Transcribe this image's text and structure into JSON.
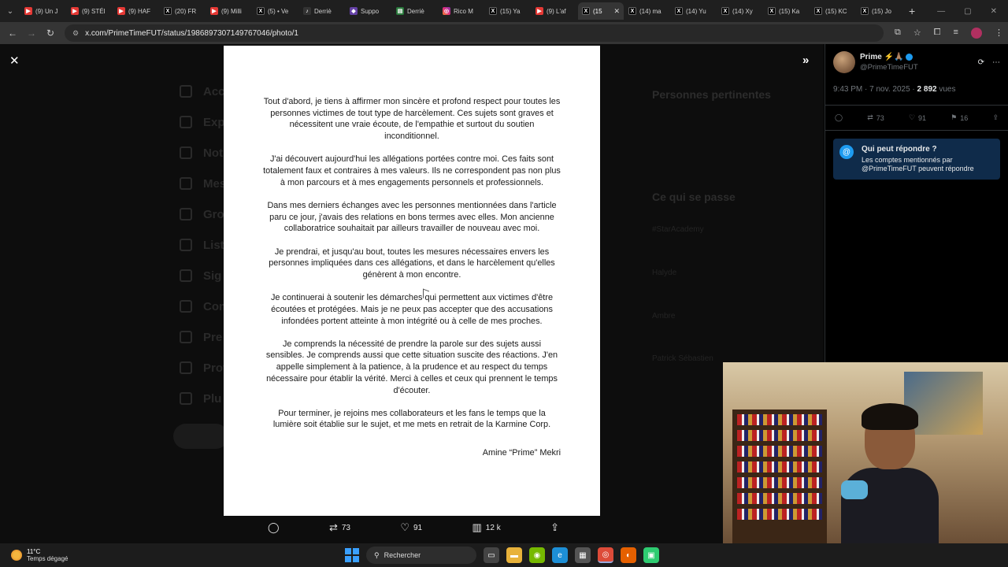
{
  "browser": {
    "tabs": [
      {
        "icon": "youtube-icon",
        "label": "(9) Un J"
      },
      {
        "icon": "youtube-icon",
        "label": "(9) STÉI"
      },
      {
        "icon": "youtube-icon",
        "label": "(9) HAF"
      },
      {
        "icon": "x-icon",
        "label": "(20) FR"
      },
      {
        "icon": "youtube-icon",
        "label": "(9) Milli"
      },
      {
        "icon": "x-icon",
        "label": "(5) • Ve"
      },
      {
        "icon": "tiktok-icon",
        "label": "Derriè"
      },
      {
        "icon": "twitch-icon",
        "label": "Suppo"
      },
      {
        "icon": "doc-icon",
        "label": "Derriè"
      },
      {
        "icon": "instagram-icon",
        "label": "Rico M"
      },
      {
        "icon": "x-icon",
        "label": "(15) Ya"
      },
      {
        "icon": "youtube-icon",
        "label": "(9) L'af"
      },
      {
        "icon": "x-icon",
        "label": "(15",
        "active": true
      },
      {
        "icon": "x-icon",
        "label": "(14) ma"
      },
      {
        "icon": "x-icon",
        "label": "(14) Yu"
      },
      {
        "icon": "x-icon",
        "label": "(14) Xy"
      },
      {
        "icon": "x-icon",
        "label": "(15) Ka"
      },
      {
        "icon": "x-icon",
        "label": "(15) KC"
      },
      {
        "icon": "x-icon",
        "label": "(15) Jo"
      }
    ],
    "url": "x.com/PrimeTimeFUT/status/1986897307149767046/photo/1"
  },
  "background": {
    "nav": [
      "Acc",
      "Exp",
      "Not",
      "Mes",
      "Gro",
      "List",
      "Sig",
      "Com",
      "Pre",
      "Prof",
      "Plu"
    ],
    "right_headings": [
      "Personnes pertinentes",
      "Ce qui se passe"
    ],
    "right_items": [
      "#StarAcademy",
      "Halyde",
      "Ambre",
      "Patrick Sébastien"
    ]
  },
  "statement": {
    "paragraphs": [
      "Tout d'abord, je tiens à affirmer mon sincère et profond respect pour toutes les personnes victimes de tout type de harcèlement. Ces sujets sont graves et nécessitent une vraie écoute, de l'empathie et surtout du soutien inconditionnel.",
      "J'ai découvert aujourd'hui les allégations portées contre moi. Ces faits sont totalement faux et contraires à mes valeurs. Ils ne correspondent pas non plus à mon parcours et à mes engagements personnels et professionnels.",
      "Dans mes derniers échanges avec les personnes mentionnées dans l'article paru ce jour, j'avais des relations en bons termes avec elles. Mon ancienne collaboratrice souhaitait par ailleurs travailler de nouveau avec moi.",
      "Je prendrai, et jusqu'au bout, toutes les mesures nécessaires envers les personnes impliquées dans ces allégations, et dans le harcèlement qu'elles génèrent à mon encontre.",
      "Je continuerai à soutenir les démarches qui permettent aux victimes d'être écoutées et protégées. Mais je ne peux pas accepter que des accusations infondées portent atteinte à mon intégrité ou à celle de mes proches.",
      "Je comprends la nécessité de prendre la parole sur des sujets aussi sensibles. Je comprends aussi que cette situation suscite des réactions. J'en appelle simplement à la patience, à la prudence et au respect du temps nécessaire pour établir la vérité. Merci à celles et ceux qui prennent le temps d'écouter.",
      "Pour terminer, je rejoins mes collaborateurs et les fans le temps que la lumière soit établie sur le sujet, et me mets en retrait de la Karmine Corp."
    ],
    "signature": "Amine “Prime” Mekri"
  },
  "media_actions": {
    "retweets": "73",
    "likes": "91",
    "views": "12 k"
  },
  "tweet": {
    "name": "Prime ⚡🙏🏽",
    "handle": "@PrimeTimeFUT",
    "time": "9:43 PM · 7 nov. 2025 · ",
    "views_count": "2 892",
    "views_label": " vues",
    "retweets": "73",
    "likes": "91",
    "bookmarks": "16",
    "reply_title": "Qui peut répondre ?",
    "reply_sub": "Les comptes mentionnés par @PrimeTimeFUT peuvent répondre"
  },
  "taskbar": {
    "temperature": "11°C",
    "weather": "Temps dégagé",
    "search_label": "Rechercher"
  },
  "colors": {
    "accent": "#1d9bf0",
    "reply_bg": "#0f2b4a",
    "panel_border": "#2f3336"
  }
}
